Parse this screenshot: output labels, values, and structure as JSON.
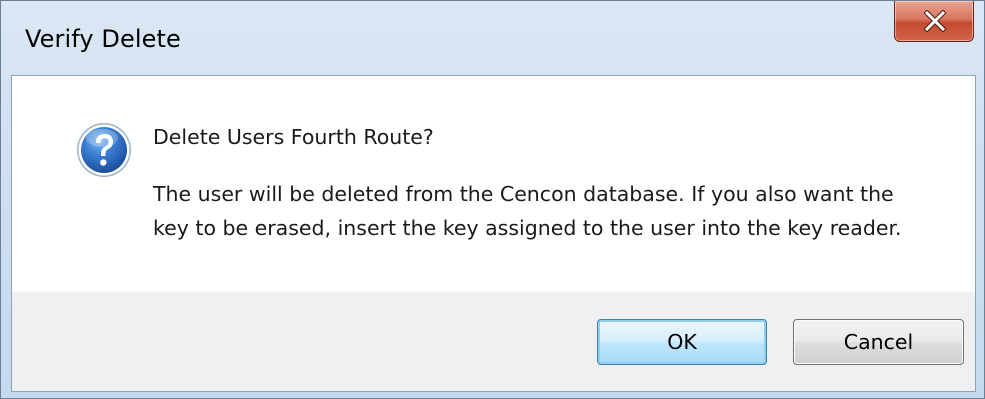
{
  "window": {
    "title": "Verify Delete",
    "close_glyph": "close-icon"
  },
  "message": {
    "icon": "question-icon",
    "heading": "Delete Users Fourth Route?",
    "body": "The user will be deleted from the Cencon database. If you also want the key to be erased, insert the key assigned to the user into the key reader."
  },
  "buttons": {
    "ok_label": "OK",
    "cancel_label": "Cancel"
  },
  "colors": {
    "close_button": "#c24a30",
    "icon_blue": "#2f6fc4",
    "ok_border": "#3c7fb1",
    "footer_bg": "#f0f0f0"
  }
}
